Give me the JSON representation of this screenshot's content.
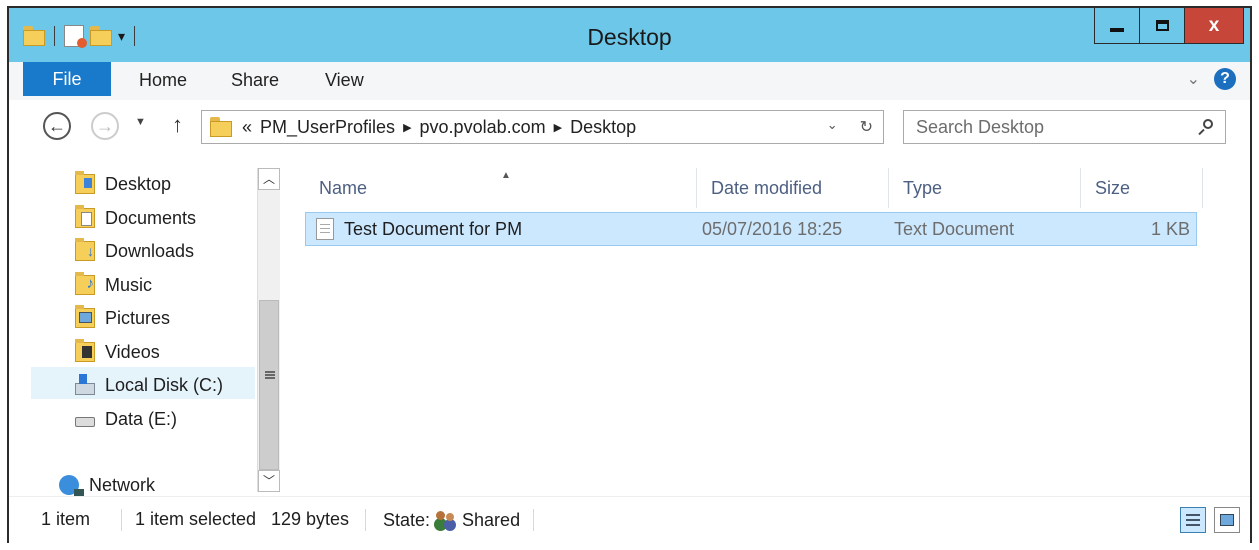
{
  "window": {
    "title": "Desktop"
  },
  "ribbon": {
    "tabs": {
      "file": "File",
      "home": "Home",
      "share": "Share",
      "view": "View"
    },
    "expand": "⌄",
    "help": "?"
  },
  "caption": {
    "minimize": "",
    "maximize": "",
    "close": "x"
  },
  "address": {
    "overflow": "«",
    "crumbs": [
      "PM_UserProfiles",
      "pvo.pvolab.com",
      "Desktop"
    ],
    "dropdown": "⌄",
    "refresh": "↻"
  },
  "search": {
    "placeholder": "Search Desktop"
  },
  "nav_pane": {
    "items": [
      {
        "label": "Desktop",
        "icon": "desktop-folder-icon"
      },
      {
        "label": "Documents",
        "icon": "documents-folder-icon"
      },
      {
        "label": "Downloads",
        "icon": "downloads-folder-icon"
      },
      {
        "label": "Music",
        "icon": "music-folder-icon"
      },
      {
        "label": "Pictures",
        "icon": "pictures-folder-icon"
      },
      {
        "label": "Videos",
        "icon": "videos-folder-icon"
      },
      {
        "label": "Local Disk (C:)",
        "icon": "local-disk-icon",
        "selected": true
      },
      {
        "label": "Data (E:)",
        "icon": "drive-icon"
      },
      {
        "label": "Network",
        "icon": "network-icon"
      }
    ]
  },
  "file_list": {
    "columns": [
      "Name",
      "Date modified",
      "Type",
      "Size"
    ],
    "sorted_by": "Name",
    "rows": [
      {
        "name": "Test Document for PM",
        "date_modified": "05/07/2016 18:25",
        "type": "Text Document",
        "size": "1 KB",
        "selected": true
      }
    ]
  },
  "status": {
    "item_count": "1 item",
    "selected_info": "1 item selected",
    "bytes": "129 bytes",
    "state_label": "State:",
    "state_value": "Shared"
  },
  "colors": {
    "title_bar": "#6cc7e9",
    "file_tab": "#1979ca",
    "close_button": "#c7463a",
    "selection": "#cce8ff"
  }
}
